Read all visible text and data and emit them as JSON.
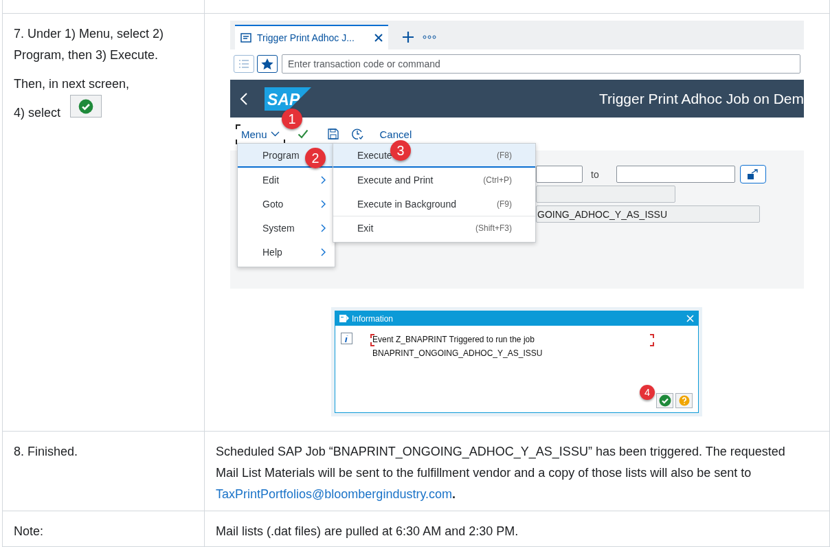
{
  "step7": {
    "instructions": [
      "7. Under 1) Menu, select 2) Program, then 3) Execute.",
      "Then, in next screen,"
    ],
    "select_label": "4) select"
  },
  "sap_screen": {
    "tab": {
      "title": "Trigger Print Adhoc J...",
      "selected": true
    },
    "command_field": {
      "placeholder": "Enter transaction code or command"
    },
    "logo": "SAP",
    "title": "Trigger Print Adhoc Job on Dem",
    "toolbar": {
      "menu": "Menu",
      "cancel": "Cancel"
    },
    "to_label": "to",
    "field_value": "GOING_ADHOC_Y_AS_ISSU",
    "menu": [
      {
        "label": "Program",
        "selected": true,
        "submenu": false
      },
      {
        "label": "Edit",
        "selected": false,
        "submenu": true
      },
      {
        "label": "Goto",
        "selected": false,
        "submenu": true
      },
      {
        "label": "System",
        "selected": false,
        "submenu": true
      },
      {
        "label": "Help",
        "selected": false,
        "submenu": true
      }
    ],
    "submenu": [
      {
        "label": "Execute",
        "shortcut": "(F8)",
        "selected": true,
        "separator_before": false
      },
      {
        "label": "Execute and Print",
        "shortcut": "(Ctrl+P)",
        "selected": false,
        "separator_before": false
      },
      {
        "label": "Execute in Background",
        "shortcut": "(F9)",
        "selected": false,
        "separator_before": false
      },
      {
        "label": "Exit",
        "shortcut": "(Shift+F3)",
        "selected": false,
        "separator_before": true
      }
    ],
    "badges": [
      "1",
      "2",
      "3"
    ]
  },
  "dialog": {
    "title": "Information",
    "message": [
      "Event Z_BNAPRINT Triggered to run the job",
      "BNAPRINT_ONGOING_ADHOC_Y_AS_ISSU"
    ],
    "badge": "4"
  },
  "step8": {
    "label": "8. Finished.",
    "text": "Scheduled SAP Job “BNAPRINT_ONGOING_ADHOC_Y_AS_ISSU” has been triggered. The requested Mail List Materials will be sent to the fulfillment vendor and a copy of those lists will also be sent to ",
    "link": "TaxPrintPortfolios@bloombergindustry.com",
    "after": "**.**"
  },
  "note": {
    "label": "Note:",
    "text": "Mail lists (.dat files) are pulled at 6:30 AM and 2:30 PM."
  }
}
